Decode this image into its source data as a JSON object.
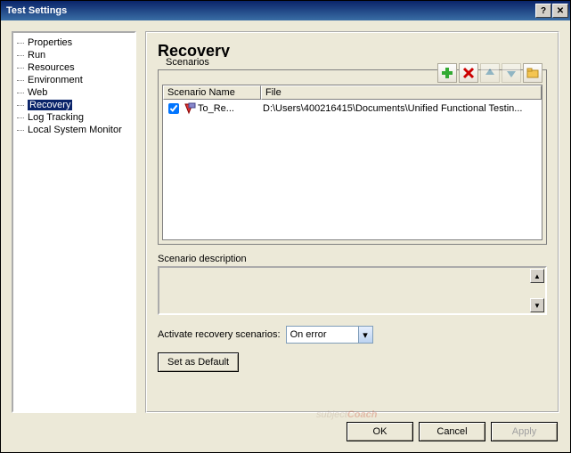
{
  "titlebar": {
    "title": "Test Settings"
  },
  "tree": {
    "items": [
      {
        "label": "Properties"
      },
      {
        "label": "Run"
      },
      {
        "label": "Resources"
      },
      {
        "label": "Environment"
      },
      {
        "label": "Web"
      },
      {
        "label": "Recovery",
        "selected": true
      },
      {
        "label": "Log Tracking"
      },
      {
        "label": "Local System Monitor"
      }
    ]
  },
  "page": {
    "heading": "Recovery",
    "scenarios_label": "Scenarios",
    "grid": {
      "col_name": "Scenario Name",
      "col_file": "File",
      "rows": [
        {
          "checked": true,
          "name": "To_Re...",
          "file": "D:\\Users\\400216415\\Documents\\Unified Functional Testin..."
        }
      ]
    },
    "desc_label": "Scenario description",
    "desc_value": "",
    "activate_label": "Activate recovery scenarios:",
    "activate_value": "On error",
    "set_default": "Set as Default"
  },
  "footer": {
    "ok": "OK",
    "cancel": "Cancel",
    "apply": "Apply"
  },
  "watermark": {
    "a": "subject",
    "b": "Coach"
  }
}
